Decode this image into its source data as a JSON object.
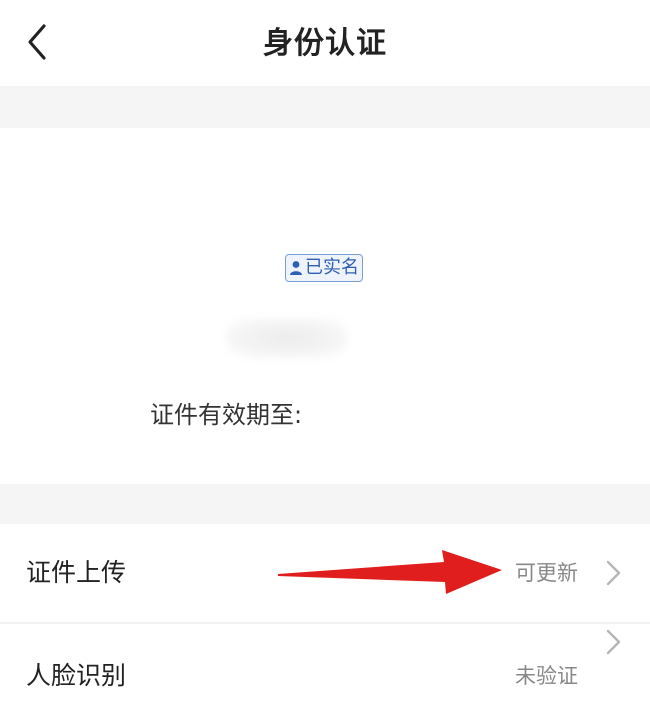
{
  "header": {
    "title": "身份认证",
    "back_icon": "chevron-left-icon"
  },
  "id_card": {
    "badge_label": "已实名",
    "badge_icon": "person-icon",
    "badge_color": "#2f5fb4",
    "validity_label": "证件有效期至:"
  },
  "list": [
    {
      "label": "证件上传",
      "status": "可更新"
    },
    {
      "label": "人脸识别",
      "status": "未验证"
    }
  ],
  "annotation": {
    "arrow_color": "#e01e1e"
  }
}
